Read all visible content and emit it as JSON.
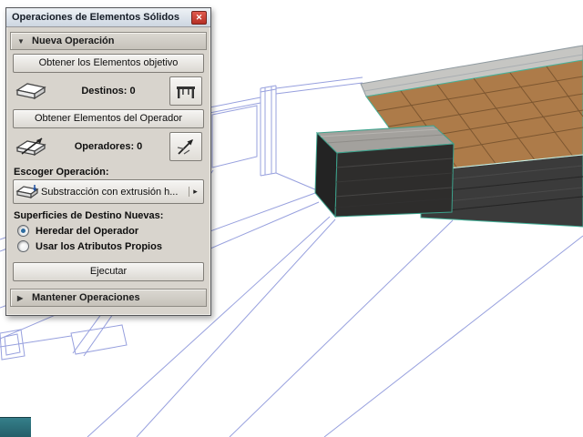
{
  "window": {
    "title": "Operaciones de Elementos Sólidos",
    "close_glyph": "✕"
  },
  "sections": {
    "new_operation": {
      "label": "Nueva Operación",
      "arrow": "▼"
    },
    "keep_operations": {
      "label": "Mantener Operaciones",
      "arrow": "▶"
    }
  },
  "targets": {
    "get_button": "Obtener los Elementos objetivo",
    "count_label": "Destinos: 0"
  },
  "operators": {
    "get_button": "Obtener Elementos del Operador",
    "count_label": "Operadores: 0"
  },
  "operation": {
    "label": "Escoger Operación:",
    "selected": "Substracción con extrusión h...",
    "arrow": "▸"
  },
  "surfaces": {
    "label": "Superficies de Destino Nuevas:",
    "options": [
      {
        "label": "Heredar del Operador",
        "selected": true
      },
      {
        "label": "Usar los Atributos Propios",
        "selected": false
      }
    ]
  },
  "execute_button": "Ejecutar",
  "colors": {
    "wireframe": "#97a0de",
    "edge_highlight": "#45b39b",
    "tile": "#ad7b49",
    "grout": "#7c5630",
    "fascia": "#3b3b3b",
    "step_top": "#a3a19d",
    "dialog_bg": "#d8d4cd",
    "close_button": "#b52f25",
    "status_corner": "#2a6f7a"
  }
}
